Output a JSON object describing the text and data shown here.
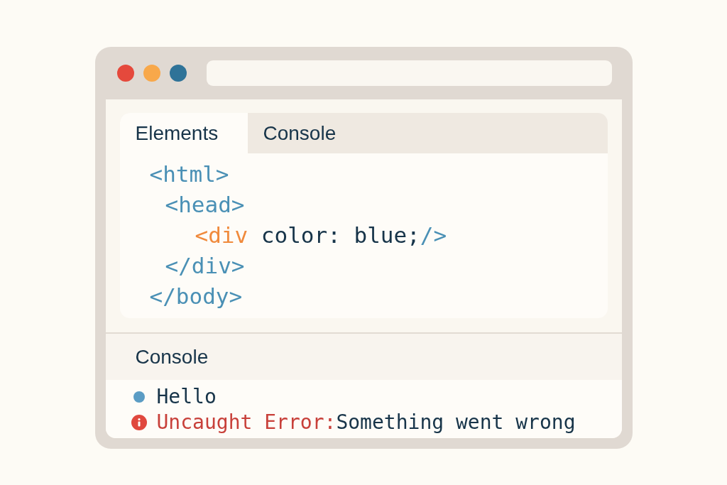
{
  "devtools": {
    "tabs": [
      {
        "label": "Elements",
        "selected": true
      },
      {
        "label": "Console",
        "selected": false
      }
    ],
    "elements_tree": [
      {
        "parts": [
          {
            "kind": "tag",
            "text": "<html>"
          }
        ],
        "children": [
          {
            "parts": [
              {
                "kind": "tag",
                "text": "<head>"
              }
            ],
            "children": [
              {
                "parts": [
                  {
                    "kind": "highlight",
                    "text": "<div"
                  },
                  {
                    "kind": "text",
                    "text": " color: blue;"
                  },
                  {
                    "kind": "tag",
                    "text": "/>"
                  }
                ]
              }
            ]
          },
          {
            "parts": [
              {
                "kind": "tag",
                "text": "</div>"
              }
            ]
          }
        ]
      },
      {
        "parts": [
          {
            "kind": "tag",
            "text": "</body>"
          }
        ]
      }
    ]
  },
  "console": {
    "title": "Console",
    "messages": [
      {
        "kind": "log",
        "parts": [
          {
            "kind": "text",
            "text": "Hello"
          }
        ]
      },
      {
        "kind": "error",
        "parts": [
          {
            "kind": "error",
            "text": "Uncaught Error:"
          },
          {
            "kind": "text",
            "text": "Something went wrong"
          }
        ]
      }
    ]
  }
}
